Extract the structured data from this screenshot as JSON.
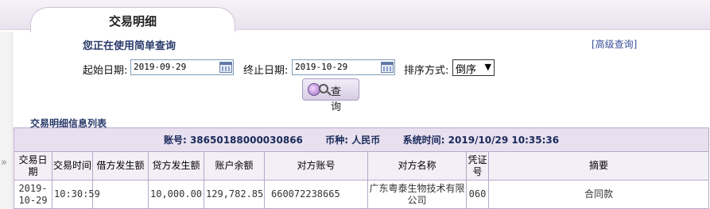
{
  "tab": {
    "title": "交易明细"
  },
  "form": {
    "mode_title": "您正在使用简单查询",
    "advanced_link": "[高级查询]",
    "start_label": "起始日期:",
    "start_value": "2019-09-29",
    "end_label": "终止日期:",
    "end_value": "2019-10-29",
    "sort_label": "排序方式:",
    "sort_value": "倒序",
    "query_button": "查 询"
  },
  "list": {
    "title": "交易明细信息列表",
    "account_label": "账号:",
    "account_value": "38650188000030866",
    "currency_label": "币种:",
    "currency_value": "人民币",
    "systime_label": "系统时间:",
    "systime_value": "2019/10/29 10:35:36",
    "columns": [
      "交易日期",
      "交易时间",
      "借方发生额",
      "贷方发生额",
      "账户余额",
      "对方账号",
      "对方名称",
      "凭证号",
      "摘要"
    ],
    "rows": [
      {
        "date": "2019-10-29",
        "time": "10:30:59",
        "debit": "",
        "credit": "10,000.00",
        "balance": "129,782.85",
        "counter_account": "660072238665",
        "counter_name": "广东粤泰生物技术有限公司",
        "voucher": "060",
        "summary": "合同款"
      }
    ]
  },
  "icons": {
    "calendar": "calendar-icon",
    "query": "globe-search-icon",
    "collapse": "double-chevron-right-icon"
  },
  "colors": {
    "accent": "#e8e0ef",
    "border": "#b8a8c8",
    "title": "#2a3a6a"
  }
}
